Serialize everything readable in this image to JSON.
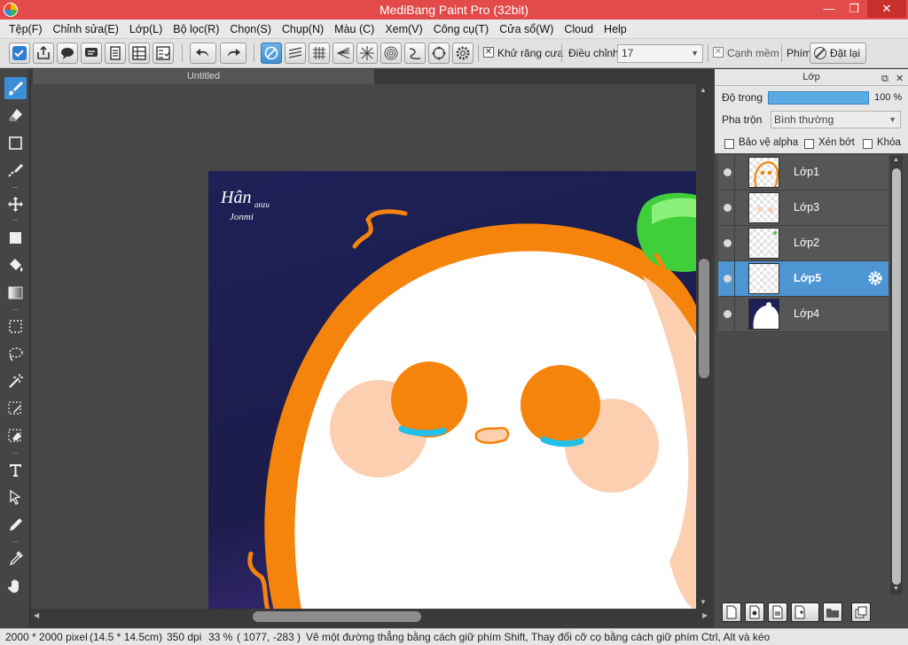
{
  "titlebar": {
    "title": "MediBang Paint Pro (32bit)",
    "minimize": "—",
    "restore": "❐",
    "close": "✕"
  },
  "menu": [
    "Tệp(F)",
    "Chỉnh sửa(E)",
    "Lớp(L)",
    "Bộ lọc(R)",
    "Chọn(S)",
    "Chụp(N)",
    "Màu (C)",
    "Xem(V)",
    "Công cụ(T)",
    "Cửa sổ(W)",
    "Cloud",
    "Help"
  ],
  "toolbar": {
    "antialias_label": "Khử răng cưa",
    "antialias_checked": true,
    "adjust_label": "Điều chỉnh",
    "adjust_value": "17",
    "smooth_label": "Cạnh mềm",
    "smooth_checked": false,
    "key_label": "Phím",
    "reset_label": "Đặt lại"
  },
  "document": {
    "tab_title": "Untitled"
  },
  "canvas_art": {
    "signature_line1": "Hân",
    "signature_line2": "anzu",
    "signature_line3": "Jonmi"
  },
  "layers_panel": {
    "title": "Lớp",
    "opacity_label": "Độ trong",
    "opacity_value": "100 %",
    "opacity_fraction": 1.0,
    "blend_label": "Pha trộn",
    "blend_value": "Bình thường",
    "protect_alpha_label": "Bảo vệ alpha",
    "clipping_label": "Xén bớt",
    "lock_label": "Khóa",
    "layers": [
      {
        "name": "Lớp1",
        "selected": false
      },
      {
        "name": "Lớp3",
        "selected": false
      },
      {
        "name": "Lớp2",
        "selected": false
      },
      {
        "name": "Lớp5",
        "selected": true
      },
      {
        "name": "Lớp4",
        "selected": false
      }
    ]
  },
  "status": {
    "size": "2000 * 2000 pixel",
    "cm": "(14.5 * 14.5cm)",
    "dpi": "350 dpi",
    "zoom": "33 %",
    "coords": "( 1077, -283 )",
    "hint": "Vẽ một đường thẳng bằng cách giữ phím Shift, Thay đổi cỡ cọ bằng cách giữ phím Ctrl, Alt và kéo"
  },
  "colors": {
    "accent": "#4d95d3",
    "title_bar": "#e34a4a",
    "panel_bg": "#4a4a4a",
    "canvas_bg": "#1c1f4e",
    "orange": "#f5840c"
  }
}
